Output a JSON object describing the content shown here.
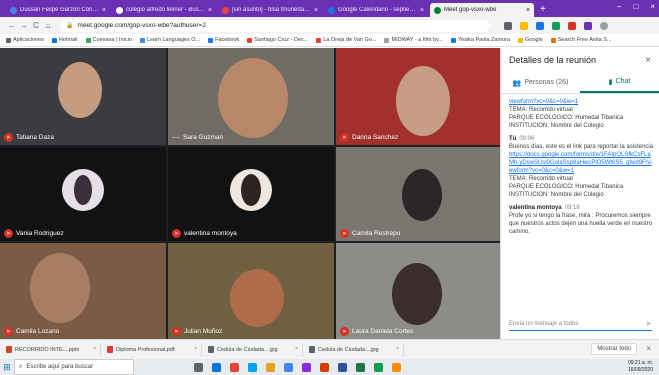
{
  "browser": {
    "tabs": [
      {
        "title": "Dussan Felipe Garzon Conde | M",
        "icon_color": "#4285f4",
        "active": false
      },
      {
        "title": "colegio alfredo lekner - Busca",
        "icon_color": "#ffffff",
        "active": false
      },
      {
        "title": "[sin asunto] - blsa fmunedal@gm",
        "icon_color": "#ea4335",
        "active": false
      },
      {
        "title": "Google Calendario - septiembre",
        "icon_color": "#1a73e8",
        "active": false
      },
      {
        "title": "Meet gop-vsxo-wbe",
        "icon_color": "#00832d",
        "active": true
      }
    ],
    "close_glyph": "×",
    "new_tab": "+",
    "window_controls": [
      "–",
      "□",
      "×"
    ],
    "url": "meet.google.com/gop-vsxo-wbe?authuser=2",
    "nav": [
      "←",
      "→",
      "C",
      "⌂"
    ],
    "bookmarks": [
      {
        "label": "Aplicaciones",
        "color": "#5f6368"
      },
      {
        "label": "Hotmail",
        "color": "#0078d4"
      },
      {
        "label": "Cuevana | Inicio",
        "color": "#34a853"
      },
      {
        "label": "Learn Languages O...",
        "color": "#4285f4"
      },
      {
        "label": "Facebook",
        "color": "#1877f2"
      },
      {
        "label": "Santiago Cruz - Dec...",
        "color": "#ea4335"
      },
      {
        "label": "La Oreja de Van Go...",
        "color": "#ea4335"
      },
      {
        "label": "MIDWAY - a film by...",
        "color": "#9aa0a6"
      },
      {
        "label": "Yesika Paola Zamora",
        "color": "#1877f2"
      },
      {
        "label": "Google",
        "color": "#fbbc04"
      },
      {
        "label": "Search Free Anita S...",
        "color": "#e37400"
      }
    ]
  },
  "participants": [
    {
      "name": "Tatiana Daza",
      "bg": "#3a3c40",
      "muted": true
    },
    {
      "name": "Sara Guzman",
      "bg": "#6f6c66",
      "muted": false
    },
    {
      "name": "Danna Sanchez",
      "bg": "#a2312b",
      "muted": true
    },
    {
      "name": "Vania Rodriguez",
      "bg": "#111214",
      "muted": true
    },
    {
      "name": "valentina montoya",
      "bg": "#111214",
      "muted": true
    },
    {
      "name": "Camila Restrepo",
      "bg": "#7a7670",
      "muted": true
    },
    {
      "name": "Camila Lozano",
      "bg": "#7c5b46",
      "muted": true
    },
    {
      "name": "Julian Muñoz",
      "bg": "#6e6040",
      "muted": true
    },
    {
      "name": "Laura Daniela Cortes",
      "bg": "#8d8c89",
      "muted": true
    }
  ],
  "panel": {
    "title": "Detalles de la reunión",
    "close": "×",
    "tab_people": "Personas (26)",
    "tab_chat": "Chat",
    "chat_top": {
      "link_tail": "viewform?vc=0&c=0&w=1",
      "lines": [
        "TEMA: Recorrido virtual",
        "PARQUE ECOLOGICO: Humedal Tibanica",
        "INSTITUCION: Nombre del Colegio"
      ]
    },
    "msg2": {
      "sender": "Tú",
      "time": "09:06",
      "text": "Buenos días, este es el link para reportar la asistencia",
      "link": "https://docs.google.com/forms/d/e/1FAIpQLSfkCsFLaMh-yDswSUsl0GolaSsp8aHwcPlO5Wt6S5_gfwd9F/viewform?vc=0&c=0&w=1",
      "lines": [
        "TEMA: Recorrido virtual",
        "PARQUE ECOLOGICO: Humedal Tibanica",
        "INSTITUCION: Nombre del Colegio"
      ]
    },
    "msg3": {
      "sender": "valentina montoya",
      "time": "09:18",
      "text": "Profe yo si tengo la frase, mira : Procuremos siempre que nuestros actos dejen una huella verde en nuestro camino."
    },
    "input_placeholder": "Envía un mensaje a todos",
    "send": "➤"
  },
  "downloads": {
    "files": [
      {
        "name": "RECORRIDO INTE....pptx",
        "color": "#d24726"
      },
      {
        "name": "Diploma Profesional.pdf",
        "color": "#e53935"
      },
      {
        "name": "Cedula de Ciudada....jpg",
        "color": "#5f6368"
      },
      {
        "name": "Cedula de Ciudada....jpg",
        "color": "#5f6368"
      }
    ],
    "caret": "^",
    "show_all": "Mostrar todo",
    "close": "×"
  },
  "taskbar": {
    "search_placeholder": "Escribe aquí para buscar",
    "apps": [
      "#5f6368",
      "#0078d7",
      "#ea4335",
      "#00a4ef",
      "#e3a21a",
      "#4285f4",
      "#8a2be2",
      "#d83b01",
      "#2b579a",
      "#217346",
      "#0f9d58",
      "#ff8c00"
    ],
    "time": "09:21 a. m.",
    "date": "16/09/2020"
  }
}
